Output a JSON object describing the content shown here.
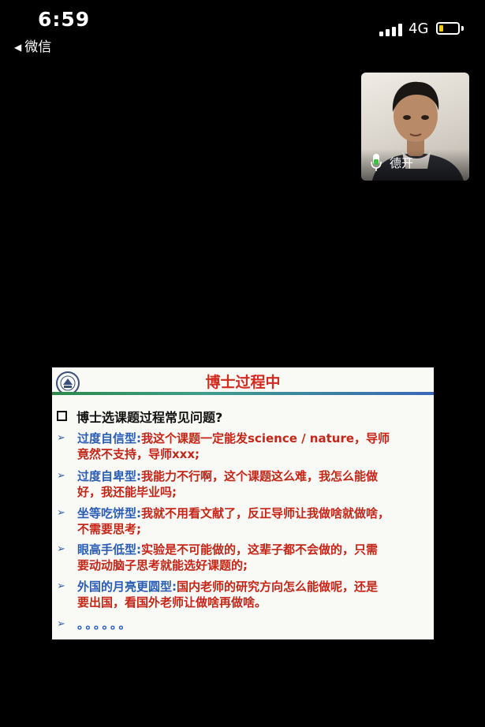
{
  "status_bar": {
    "time": "6:59",
    "back_label": "微信",
    "network": "4G",
    "icons": [
      "signal-icon",
      "battery-icon"
    ],
    "battery_color": "#f5cc00"
  },
  "participant": {
    "name": "德开",
    "icon": "microphone-icon"
  },
  "slide": {
    "title": "博士过程中",
    "heading": "博士选课题过程常见问题?",
    "items": [
      {
        "term": "过度自信型:",
        "line1": "我这个课题一定能发science / nature，导师",
        "line2": "竟然不支持，导师xxx;"
      },
      {
        "term": "过度自卑型:",
        "line1": "我能力不行啊，这个课题这么难，我怎么能做",
        "line2": "好，我还能毕业吗;"
      },
      {
        "term": "坐等吃饼型:",
        "line1": "我就不用看文献了，反正导师让我做啥就做啥，",
        "line2": "不需要思考;"
      },
      {
        "term": "眼高手低型:",
        "line1": "实验是不可能做的，这辈子都不会做的，只需",
        "line2": "要动动脑子思考就能选好课题的;"
      },
      {
        "term": "外国的月亮更圆型:",
        "line1": "国内老师的研究方向怎么能做呢，还是",
        "line2": "要出国，看国外老师让做啥再做啥。"
      }
    ],
    "ellipsis": "。。。。。。",
    "colors": {
      "title": "#d42a1f",
      "term": "#2a5db3",
      "body": "#c42618"
    }
  }
}
